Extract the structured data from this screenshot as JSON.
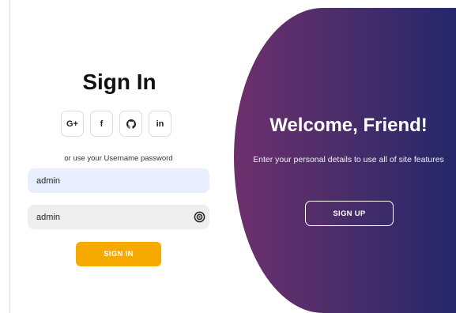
{
  "signin": {
    "title": "Sign In",
    "socials": [
      {
        "label": "G+",
        "icon": "google-plus-icon"
      },
      {
        "label": "f",
        "icon": "facebook-icon"
      },
      {
        "label": "",
        "icon": "github-icon"
      },
      {
        "label": "in",
        "icon": "linkedin-icon"
      }
    ],
    "alt_text": "or use your Username password",
    "username_value": "admin",
    "password_value": "admin",
    "button_label": "SIGN IN"
  },
  "welcome": {
    "title": "Welcome, Friend!",
    "text": "Enter your personal details to use all of site features",
    "button_label": "SIGN UP"
  },
  "colors": {
    "accent": "#f7a900",
    "gradient_start": "#6d2f6d",
    "gradient_end": "#24286a",
    "username_bg": "#e9efff",
    "password_bg": "#eeeeee"
  }
}
